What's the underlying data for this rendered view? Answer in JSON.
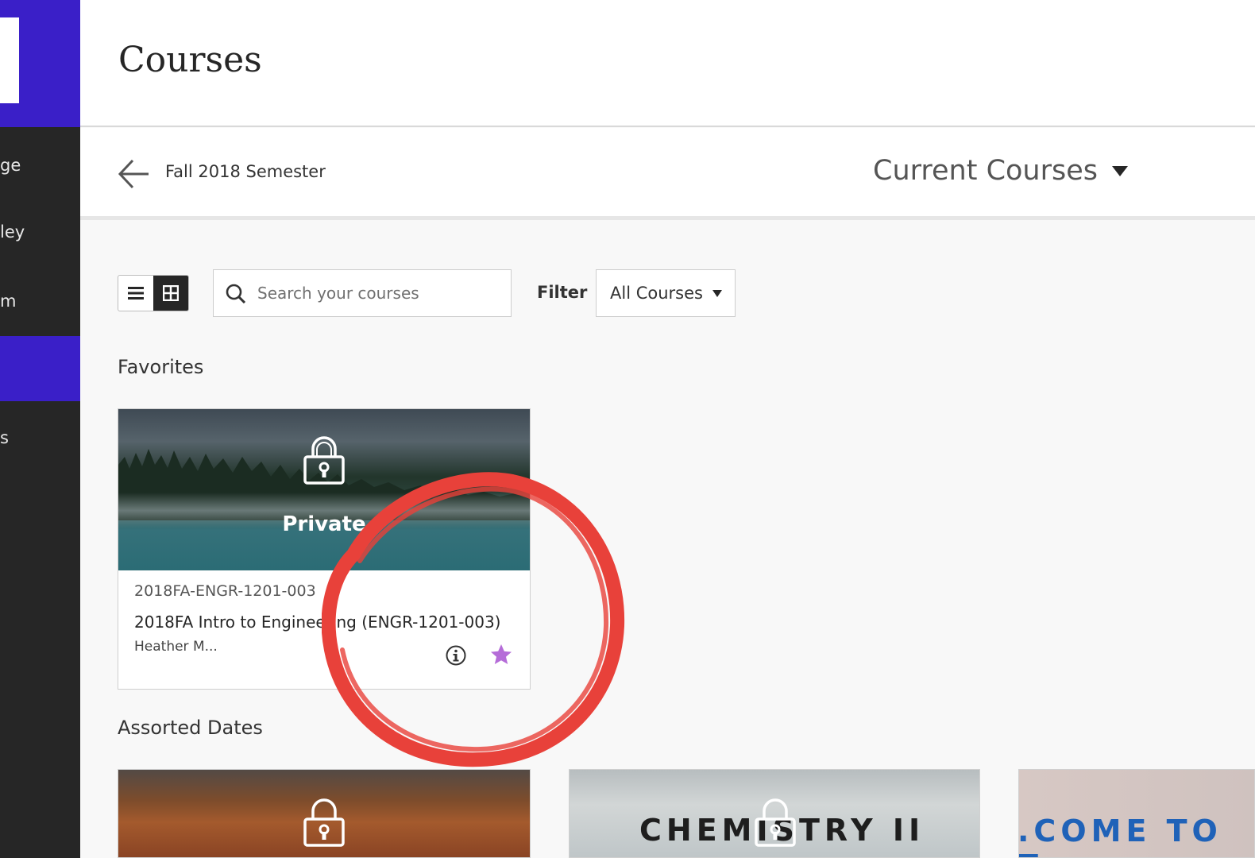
{
  "sidebar": {
    "items": [
      {
        "label": "ge",
        "active": false
      },
      {
        "label": "ley",
        "active": false
      },
      {
        "label": "m",
        "active": false
      },
      {
        "label": "",
        "active": true
      },
      {
        "label": "s",
        "active": false
      }
    ],
    "accent_color": "#3a1fc8"
  },
  "header": {
    "title": "Courses"
  },
  "subheader": {
    "back_icon": "arrow-left-icon",
    "semester_label": "Fall 2018 Semester",
    "term_selected": "Current Courses"
  },
  "toolbar": {
    "view_modes": [
      "list-view-icon",
      "grid-view-icon"
    ],
    "active_view": "grid",
    "search_placeholder": "Search your courses",
    "search_value": "",
    "filter_label": "Filter",
    "filter_selected": "All Courses"
  },
  "sections": {
    "favorites_heading": "Favorites",
    "assorted_heading": "Assorted Dates"
  },
  "favorite_course": {
    "status": "Private",
    "course_id": "2018FA-ENGR-1201-003",
    "course_name": "2018FA Intro to Engineering (ENGR-1201-003)",
    "instructor": "Heather M...",
    "favorited": true,
    "star_color": "#b56cd8"
  },
  "assorted_courses": [
    {
      "banner_text": "",
      "locked": true
    },
    {
      "banner_text": "CHEMISTRY II",
      "locked": true
    },
    {
      "banner_text": ".COME TO T",
      "locked": false
    }
  ],
  "annotation": {
    "color": "#e8413a"
  }
}
